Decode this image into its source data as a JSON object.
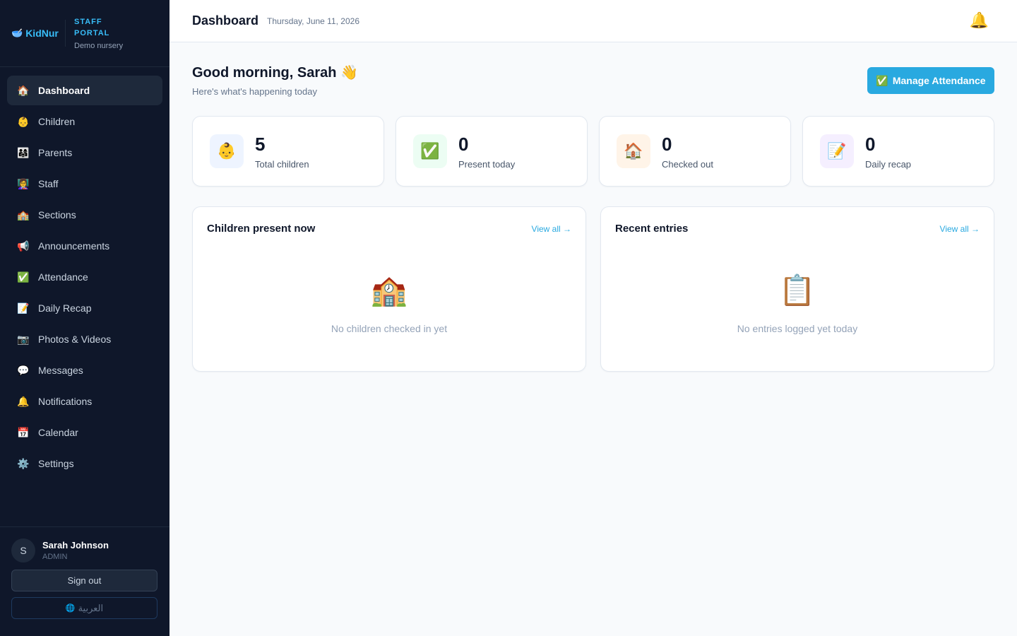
{
  "brand": {
    "logo_icon": "🥣",
    "logo_text": "KidNur",
    "portal_label": "STAFF PORTAL",
    "subtitle": "Demo nursery"
  },
  "nav": [
    {
      "icon": "🏠",
      "label": "Dashboard",
      "active": true
    },
    {
      "icon": "👶",
      "label": "Children"
    },
    {
      "icon": "👨‍👩‍👧",
      "label": "Parents"
    },
    {
      "icon": "👩‍🏫",
      "label": "Staff"
    },
    {
      "icon": "🏫",
      "label": "Sections"
    },
    {
      "icon": "📢",
      "label": "Announcements"
    },
    {
      "icon": "✅",
      "label": "Attendance"
    },
    {
      "icon": "📝",
      "label": "Daily Recap"
    },
    {
      "icon": "📷",
      "label": "Photos & Videos"
    },
    {
      "icon": "💬",
      "label": "Messages"
    },
    {
      "icon": "🔔",
      "label": "Notifications"
    },
    {
      "icon": "📅",
      "label": "Calendar"
    },
    {
      "icon": "⚙️",
      "label": "Settings"
    }
  ],
  "user": {
    "initial": "S",
    "name": "Sarah Johnson",
    "role": "ADMIN"
  },
  "footer": {
    "sign_out": "Sign out",
    "language_icon": "🌐",
    "language": "العربية"
  },
  "topbar": {
    "title": "Dashboard",
    "date": "Thursday, June 11, 2026",
    "bell_icon": "🔔"
  },
  "greeting": {
    "title": "Good morning, Sarah 👋",
    "subtitle": "Here's what's happening today"
  },
  "primary_action": {
    "icon": "✅",
    "label": "Manage Attendance"
  },
  "stats": [
    {
      "icon": "👶",
      "value": "5",
      "label": "Total children",
      "bg": "#eef4ff"
    },
    {
      "icon": "✅",
      "value": "0",
      "label": "Present today",
      "bg": "#ecfdf3"
    },
    {
      "icon": "🏠",
      "value": "0",
      "label": "Checked out",
      "bg": "#fff4e8"
    },
    {
      "icon": "📝",
      "value": "0",
      "label": "Daily recap",
      "bg": "#f5efff"
    }
  ],
  "panels": [
    {
      "title": "Children present now",
      "link": "View all →",
      "empty_icon": "🏫",
      "empty_text": "No children checked in yet"
    },
    {
      "title": "Recent entries",
      "link": "View all →",
      "empty_icon": "📋",
      "empty_text": "No entries logged yet today"
    }
  ],
  "colors": {
    "sidebar_bg": "#0f172a",
    "accent": "#29a9e0",
    "page_bg": "#f8fafc"
  }
}
